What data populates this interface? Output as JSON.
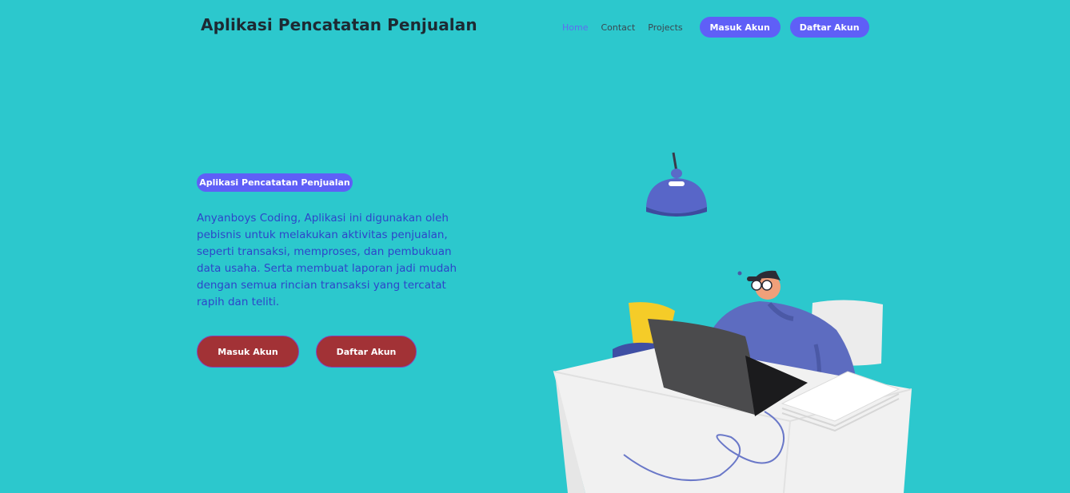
{
  "header": {
    "brand": "Aplikasi Pencatatan Penjualan",
    "nav": {
      "home": "Home",
      "contact": "Contact",
      "projects": "Projects",
      "login": "Masuk Akun",
      "register": "Daftar Akun"
    }
  },
  "hero": {
    "tag": "Aplikasi Pencatatan Penjualan",
    "description": "Anyanboys Coding, Aplikasi ini digunakan oleh pebisnis untuk melakukan aktivitas penjualan, seperti transaksi, memproses, dan pembukuan data usaha. Serta membuat laporan jadi mudah dengan semua rincian transaksi yang tercatat rapih dan teliti.",
    "login_button": "Masuk Akun",
    "register_button": "Daftar Akun"
  },
  "colors": {
    "background": "#2cc8cd",
    "primary": "#5f5ff7",
    "cta": "#a23236",
    "description_text": "#2d45c9"
  }
}
